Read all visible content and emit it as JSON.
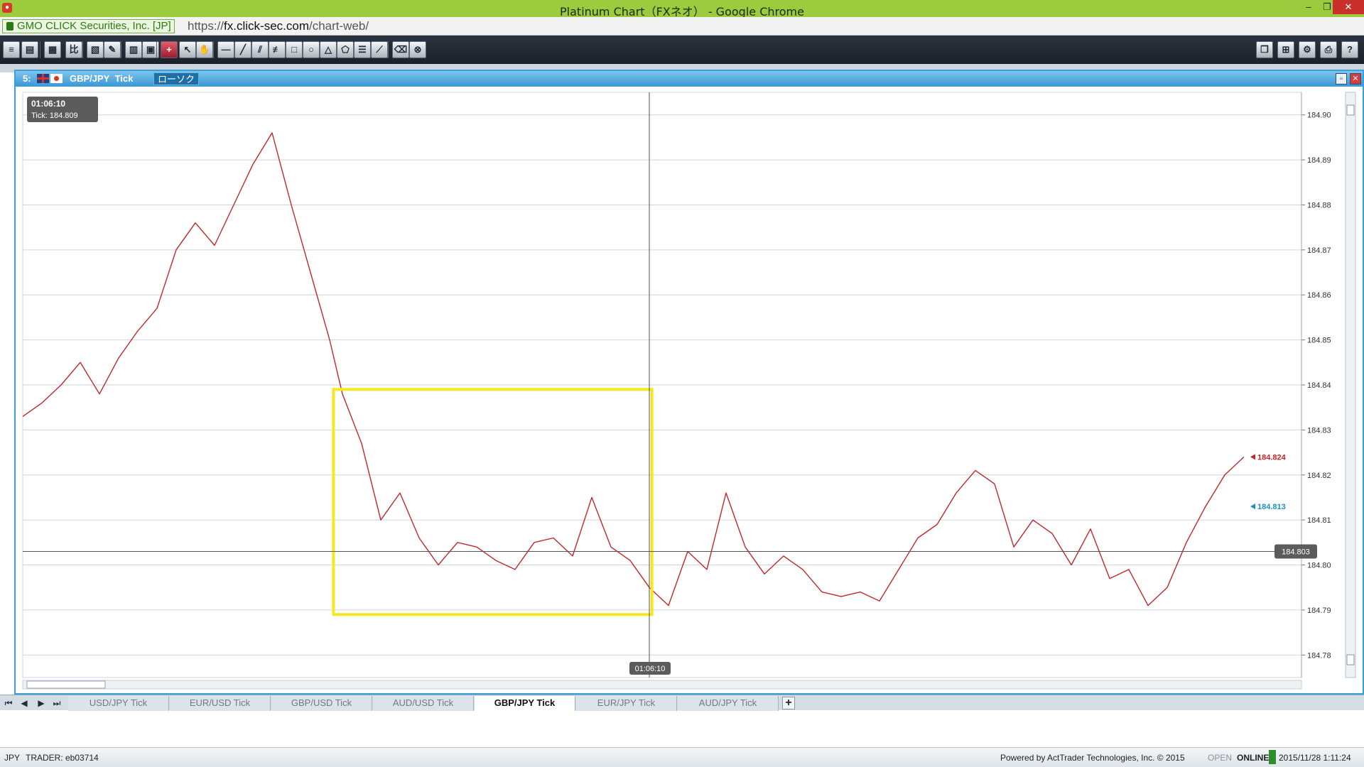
{
  "browser": {
    "title": "Platinum Chart（FXネオ） - Google Chrome",
    "site_identity": "GMO CLICK Securities, Inc. [JP]",
    "url_scheme": "https://",
    "url_host": "fx.click-sec.com",
    "url_path": "/chart-web/"
  },
  "window": {
    "number": "5:",
    "symbol": "GBP/JPY",
    "mode": "Tick",
    "chart_type": "ローソク"
  },
  "cursor": {
    "time": "01:06:10",
    "tick_label": "Tick:",
    "tick_value": "184.809",
    "line_price": "184.803"
  },
  "price_tags": {
    "ask": "184.824",
    "bid": "184.813",
    "ask_color": "#c0282a",
    "bid_color": "#1d8fc4"
  },
  "chart_data": {
    "type": "line",
    "title": "",
    "xlabel": "",
    "ylabel": "",
    "ylim": [
      184.775,
      184.905
    ],
    "yticks": [
      "184.90",
      "184.89",
      "184.88",
      "184.87",
      "184.86",
      "184.85",
      "184.84",
      "184.83",
      "184.82",
      "184.81",
      "184.80",
      "184.79",
      "184.78"
    ],
    "grid": true,
    "line_color": "#c0282a",
    "highlight_color": "#f5e81c",
    "x_range": [
      0,
      100
    ],
    "series": [
      {
        "x": [
          0,
          1.5,
          3,
          4.5,
          6,
          7.5,
          9,
          10.5,
          12,
          13.5,
          15,
          16.5,
          18,
          19.5,
          21,
          22.5,
          24,
          25,
          26.5,
          28,
          29.5,
          31,
          32.5,
          34,
          35.5,
          37,
          38.5,
          40,
          41.5,
          43,
          44.5,
          46,
          47.5,
          49,
          50.5,
          52,
          53.5,
          55,
          56.5,
          58,
          59.5,
          61,
          62.5,
          64,
          65.5,
          67,
          68.5,
          70,
          71.5,
          73,
          74.5,
          76,
          77.5,
          79,
          80.5,
          82,
          83.5,
          85,
          86.5,
          88,
          89.5,
          91,
          92.5,
          94,
          95.5
        ],
        "values": [
          184.833,
          184.836,
          184.84,
          184.845,
          184.838,
          184.846,
          184.852,
          184.857,
          184.87,
          184.876,
          184.871,
          184.88,
          184.889,
          184.896,
          184.88,
          184.865,
          184.85,
          184.838,
          184.827,
          184.81,
          184.816,
          184.806,
          184.8,
          184.805,
          184.804,
          184.801,
          184.799,
          184.805,
          184.806,
          184.802,
          184.815,
          184.804,
          184.801,
          184.795,
          184.791,
          184.803,
          184.799,
          184.816,
          184.804,
          184.798,
          184.802,
          184.799,
          184.794,
          184.793,
          184.794,
          184.792,
          184.799,
          184.806,
          184.809,
          184.816,
          184.821,
          184.818,
          184.804,
          184.81,
          184.807,
          184.8,
          184.808,
          184.797,
          184.799,
          184.791,
          184.795,
          184.805,
          184.813,
          184.82,
          184.824
        ]
      }
    ]
  },
  "symbol_tabs": [
    "USD/JPY Tick",
    "EUR/USD Tick",
    "GBP/USD Tick",
    "AUD/USD Tick",
    "GBP/JPY Tick",
    "EUR/JPY Tick",
    "AUD/JPY Tick"
  ],
  "active_tab": "GBP/JPY Tick",
  "status": {
    "currency": "JPY",
    "trader": "TRADER: eb03714",
    "powered_by": "Powered by ActTrader Technologies, Inc. © 2015",
    "market": "OPEN",
    "connection": "ONLINE",
    "datetime": "2015/11/28 1:11:24"
  },
  "icons": {
    "toolbar": [
      "list-icon",
      "order-icon",
      "calendar-icon",
      "compare-icon",
      "indicator-icon",
      "pencil-icon",
      "print-icon",
      "save-icon",
      "crosshair-icon",
      "pointer-icon",
      "hand-icon",
      "hline-icon",
      "trendline-icon",
      "channel-icon",
      "fib-icon",
      "rectangle-icon",
      "circle-icon",
      "triangle-icon",
      "pentagon-icon",
      "lines-icon",
      "fan-icon",
      "eraser-icon",
      "delete-all-icon"
    ],
    "toolbar_right": [
      "window-icon",
      "tile-icon",
      "gear-icon",
      "printer-icon",
      "help-icon"
    ]
  }
}
